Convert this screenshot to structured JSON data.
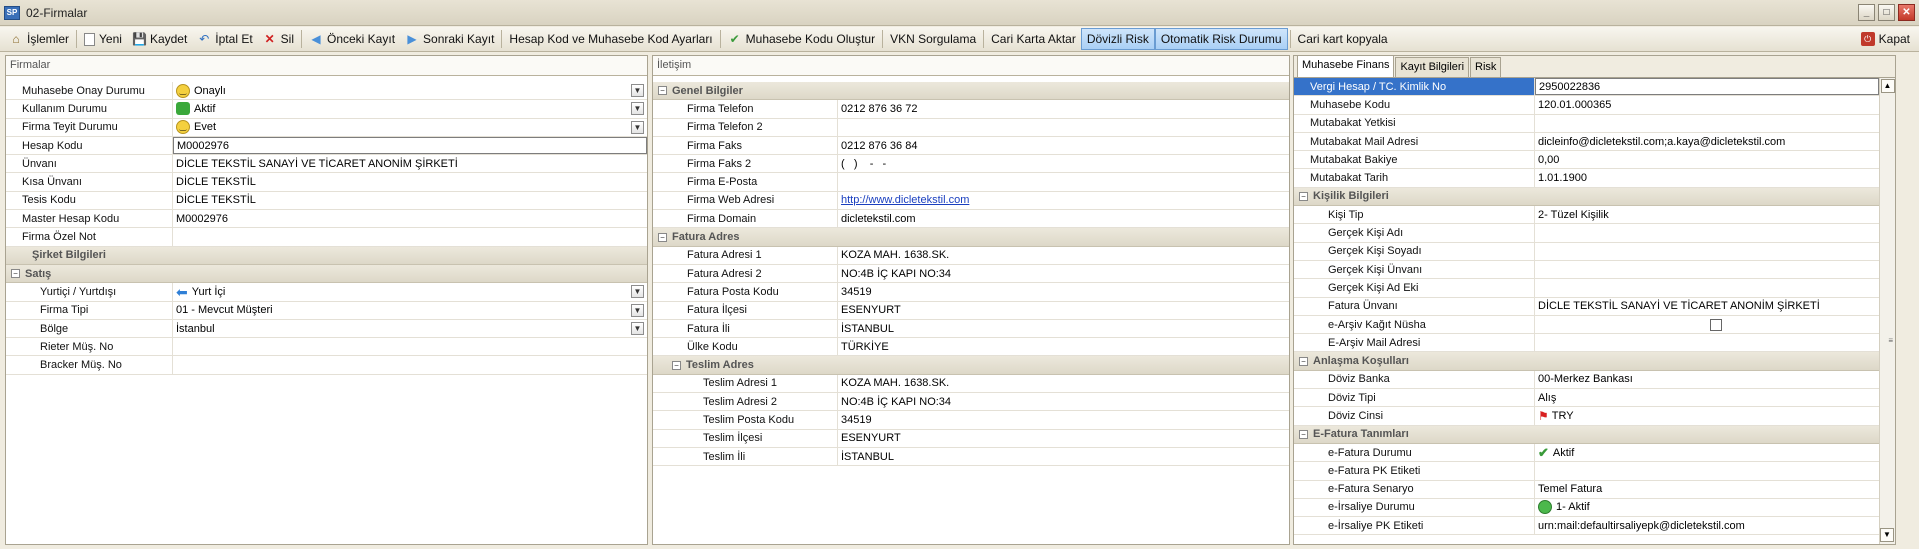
{
  "window": {
    "title": "02-Firmalar",
    "app_icon": "SP"
  },
  "toolbar": {
    "islemler": "İşlemler",
    "yeni": "Yeni",
    "kaydet": "Kaydet",
    "iptal": "İptal Et",
    "sil": "Sil",
    "onceki": "Önceki Kayıt",
    "sonraki": "Sonraki Kayıt",
    "hesap_kod": "Hesap Kod ve Muhasebe Kod Ayarları",
    "muhasebe_kodu": "Muhasebe Kodu Oluştur",
    "vkn": "VKN Sorgulama",
    "cari_aktar": "Cari Karta Aktar",
    "dovizli_risk": "Dövizli Risk",
    "otomatik_risk": "Otomatik Risk Durumu",
    "cari_kopyala": "Cari kart kopyala",
    "kapat": "Kapat"
  },
  "left": {
    "header": "Firmalar",
    "rows": [
      {
        "label": "Muhasebe Onay Durumu",
        "value": "Onaylı"
      },
      {
        "label": "Kullanım Durumu",
        "value": "Aktif"
      },
      {
        "label": "Firma Teyit Durumu",
        "value": "Evet"
      },
      {
        "label": "Hesap Kodu",
        "value": "M0002976"
      },
      {
        "label": "Ünvanı",
        "value": "DİCLE TEKSTİL SANAYİ VE TİCARET ANONİM ŞİRKETİ"
      },
      {
        "label": "Kısa Ünvanı",
        "value": "DİCLE TEKSTİL"
      },
      {
        "label": "Tesis Kodu",
        "value": "DİCLE TEKSTİL"
      },
      {
        "label": "Master Hesap Kodu",
        "value": "M0002976"
      },
      {
        "label": "Firma Özel Not",
        "value": ""
      }
    ],
    "cat_sirket": "Şirket Bilgileri",
    "cat_satis": "Satış",
    "satis_rows": [
      {
        "label": "Yurtiçi / Yurtdışı",
        "value": "Yurt İçi"
      },
      {
        "label": "Firma Tipi",
        "value": "01 - Mevcut Müşteri"
      },
      {
        "label": "Bölge",
        "value": "İstanbul"
      },
      {
        "label": "Rieter Müş. No",
        "value": ""
      },
      {
        "label": "Bracker Müş. No",
        "value": ""
      }
    ]
  },
  "middle": {
    "header": "İletişim",
    "cat_genel": "Genel Bilgiler",
    "genel_rows": [
      {
        "label": "Firma Telefon",
        "value": "0212  876 36 72"
      },
      {
        "label": "Firma Telefon 2",
        "value": ""
      },
      {
        "label": "Firma Faks",
        "value": "0212 876 36 84"
      },
      {
        "label": "Firma Faks 2",
        "value": "(   )    -   -"
      },
      {
        "label": "Firma E-Posta",
        "value": ""
      },
      {
        "label": "Firma Web Adresi",
        "value": "http://www.dicletekstil.com"
      },
      {
        "label": "Firma Domain",
        "value": "dicletekstil.com"
      }
    ],
    "cat_fatura": "Fatura Adres",
    "fatura_rows": [
      {
        "label": "Fatura Adresi 1",
        "value": "KOZA MAH. 1638.SK."
      },
      {
        "label": "Fatura Adresi 2",
        "value": "NO:4B İÇ KAPI NO:34"
      },
      {
        "label": "Fatura Posta Kodu",
        "value": "34519"
      },
      {
        "label": "Fatura İlçesi",
        "value": "ESENYURT"
      },
      {
        "label": "Fatura İli",
        "value": "İSTANBUL"
      },
      {
        "label": "Ülke Kodu",
        "value": "TÜRKİYE"
      }
    ],
    "cat_teslim": "Teslim Adres",
    "teslim_rows": [
      {
        "label": "Teslim Adresi 1",
        "value": "KOZA MAH. 1638.SK."
      },
      {
        "label": "Teslim Adresi 2",
        "value": "NO:4B İÇ KAPI NO:34"
      },
      {
        "label": "Teslim Posta Kodu",
        "value": "34519"
      },
      {
        "label": "Teslim İlçesi",
        "value": "ESENYURT"
      },
      {
        "label": "Teslim İli",
        "value": "İSTANBUL"
      }
    ]
  },
  "right": {
    "tabs": [
      "Muhasebe Finans",
      "Kayıt Bilgileri",
      "Risk"
    ],
    "top_rows": [
      {
        "label": "Vergi Hesap / TC. Kimlik No",
        "value": "2950022836"
      },
      {
        "label": "Muhasebe Kodu",
        "value": "120.01.000365"
      },
      {
        "label": "Mutabakat Yetkisi",
        "value": ""
      },
      {
        "label": "Mutabakat Mail Adresi",
        "value": "dicleinfo@dicletekstil.com;a.kaya@dicletekstil.com"
      },
      {
        "label": "Mutabakat Bakiye",
        "value": "0,00"
      },
      {
        "label": "Mutabakat Tarih",
        "value": "1.01.1900"
      }
    ],
    "cat_kisilik": "Kişilik Bilgileri",
    "kisilik_rows": [
      {
        "label": "Kişi Tip",
        "value": "2- Tüzel Kişilik"
      },
      {
        "label": "Gerçek Kişi Adı",
        "value": ""
      },
      {
        "label": "Gerçek Kişi Soyadı",
        "value": ""
      },
      {
        "label": "Gerçek Kişi Ünvanı",
        "value": ""
      },
      {
        "label": "Gerçek Kişi Ad Eki",
        "value": ""
      },
      {
        "label": "Fatura Ünvanı",
        "value": "DİCLE TEKSTİL SANAYİ VE TİCARET ANONİM ŞİRKETİ"
      },
      {
        "label": "e-Arşiv Kağıt Nüsha",
        "value": ""
      },
      {
        "label": "E-Arşiv Mail Adresi",
        "value": ""
      }
    ],
    "cat_anlasma": "Anlaşma Koşulları",
    "anlasma_rows": [
      {
        "label": "Döviz Banka",
        "value": "00-Merkez Bankası"
      },
      {
        "label": "Döviz Tipi",
        "value": "Alış"
      },
      {
        "label": "Döviz Cinsi",
        "value": "TRY"
      }
    ],
    "cat_efatura": "E-Fatura Tanımları",
    "efatura_rows": [
      {
        "label": "e-Fatura Durumu",
        "value": "Aktif"
      },
      {
        "label": "e-Fatura PK Etiketi",
        "value": ""
      },
      {
        "label": "e-Fatura Senaryo",
        "value": "Temel Fatura"
      },
      {
        "label": "e-İrsaliye Durumu",
        "value": "1- Aktif"
      },
      {
        "label": "e-İrsaliye PK Etiketi",
        "value": "urn:mail:defaultirsaliyepk@dicletekstil.com"
      }
    ]
  }
}
